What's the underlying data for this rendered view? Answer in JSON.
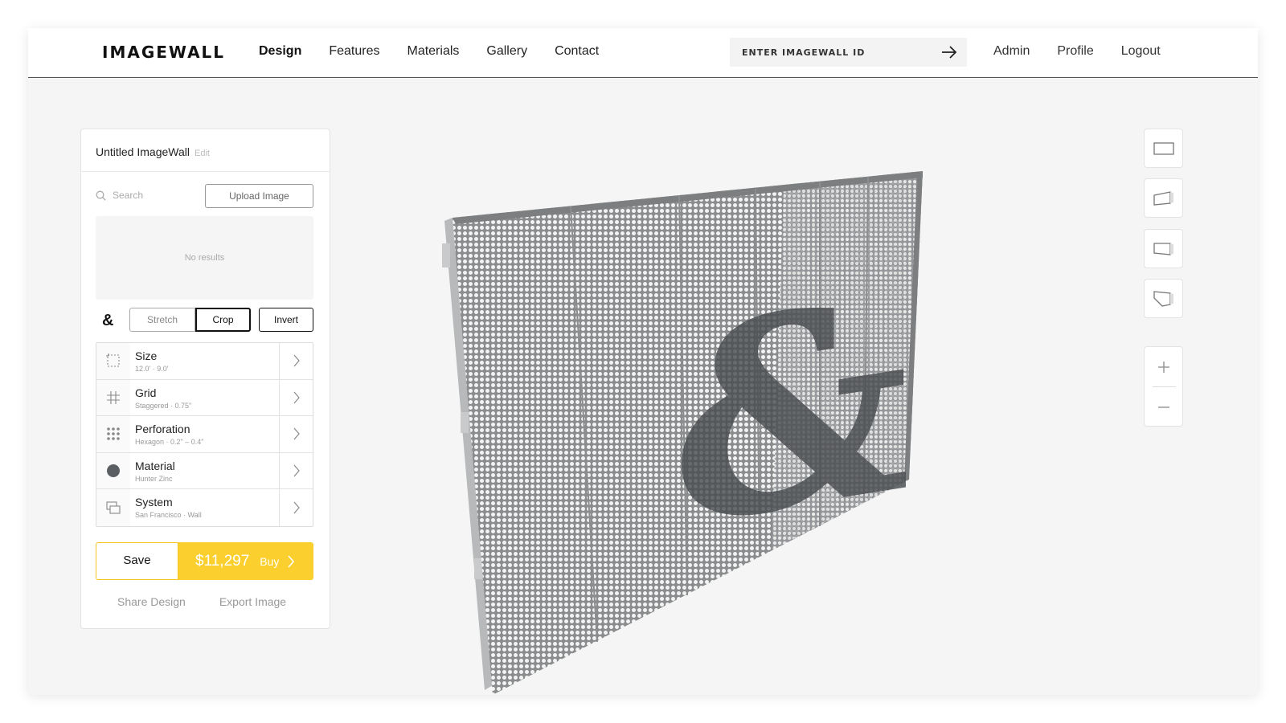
{
  "brand": {
    "logo": "IMAGEWALL"
  },
  "nav": {
    "items": [
      {
        "label": "Design",
        "active": true
      },
      {
        "label": "Features"
      },
      {
        "label": "Materials"
      },
      {
        "label": "Gallery"
      },
      {
        "label": "Contact"
      }
    ],
    "id_placeholder": "ENTER IMAGEWALL ID",
    "user_items": [
      "Admin",
      "Profile",
      "Logout"
    ]
  },
  "panel": {
    "title": "Untitled ImageWall",
    "edit_label": "Edit",
    "search_placeholder": "Search",
    "upload_label": "Upload Image",
    "no_results": "No results",
    "image_glyph": "&",
    "fit_modes": [
      "Stretch",
      "Crop"
    ],
    "selected_fit": "Crop",
    "invert_label": "Invert",
    "options": [
      {
        "name": "Size",
        "sub": "12.0' · 9.0'",
        "icon": "size-icon"
      },
      {
        "name": "Grid",
        "sub": "Staggered · 0.75\"",
        "icon": "grid-icon"
      },
      {
        "name": "Perforation",
        "sub": "Hexagon · 0.2\" – 0.4\"",
        "icon": "perforation-icon"
      },
      {
        "name": "Material",
        "sub": "Hunter Zinc",
        "icon": "material-swatch-icon"
      },
      {
        "name": "System",
        "sub": "San Francisco · Wall",
        "icon": "system-icon"
      }
    ],
    "save_label": "Save",
    "price": "$11,297",
    "buy_label": "Buy",
    "share_label": "Share Design",
    "export_label": "Export Image"
  },
  "preview": {
    "glyph": "&"
  },
  "colors": {
    "accent": "#fbcf2e",
    "accent_border": "#f6c421",
    "panel_metal": "#9a9c9e",
    "glyph_fill": "#4a4d50"
  },
  "view_buttons": [
    "front-view-icon",
    "left-perspective-icon",
    "right-perspective-icon",
    "low-perspective-icon"
  ],
  "zoom": {
    "in": "+",
    "out": "−"
  }
}
